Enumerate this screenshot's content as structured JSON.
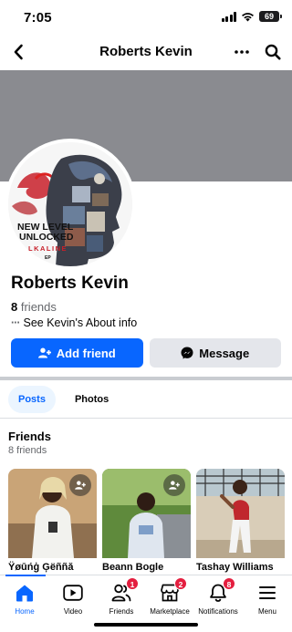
{
  "status_bar": {
    "time": "7:05",
    "battery": "69"
  },
  "header": {
    "title": "Roberts Kevin",
    "more_icon": "more-icon",
    "search_icon": "search-icon"
  },
  "profile": {
    "name": "Roberts Kevin",
    "friends_number": "8",
    "friends_word": "friends",
    "about_link": "See Kevin's About info",
    "avatar_artwork": {
      "line1": "NEW LEVEL",
      "line2": "UNLOCKED",
      "line3": "LKALINE",
      "line4": "EP"
    }
  },
  "actions": {
    "add_friend": "Add friend",
    "message": "Message"
  },
  "tabs": [
    {
      "label": "Posts",
      "active": true
    },
    {
      "label": "Photos",
      "active": false
    }
  ],
  "friends_section": {
    "title": "Friends",
    "subtitle": "8 friends",
    "cards": [
      {
        "name": "Ÿøūńģ Ģëññă"
      },
      {
        "name": "Beann Bogle"
      },
      {
        "name": "Tashay Williams"
      }
    ]
  },
  "bottom_nav": [
    {
      "label": "Home",
      "icon": "home-icon",
      "active": true,
      "badge": ""
    },
    {
      "label": "Video",
      "icon": "video-icon",
      "active": false,
      "badge": ""
    },
    {
      "label": "Friends",
      "icon": "friends-icon",
      "active": false,
      "badge": "1"
    },
    {
      "label": "Marketplace",
      "icon": "marketplace-icon",
      "active": false,
      "badge": "2"
    },
    {
      "label": "Notifications",
      "icon": "bell-icon",
      "active": false,
      "badge": "8"
    },
    {
      "label": "Menu",
      "icon": "menu-icon",
      "active": false,
      "badge": ""
    }
  ],
  "colors": {
    "primary": "#0866ff",
    "badge": "#e41e3f",
    "cover": "#8a8b90"
  }
}
